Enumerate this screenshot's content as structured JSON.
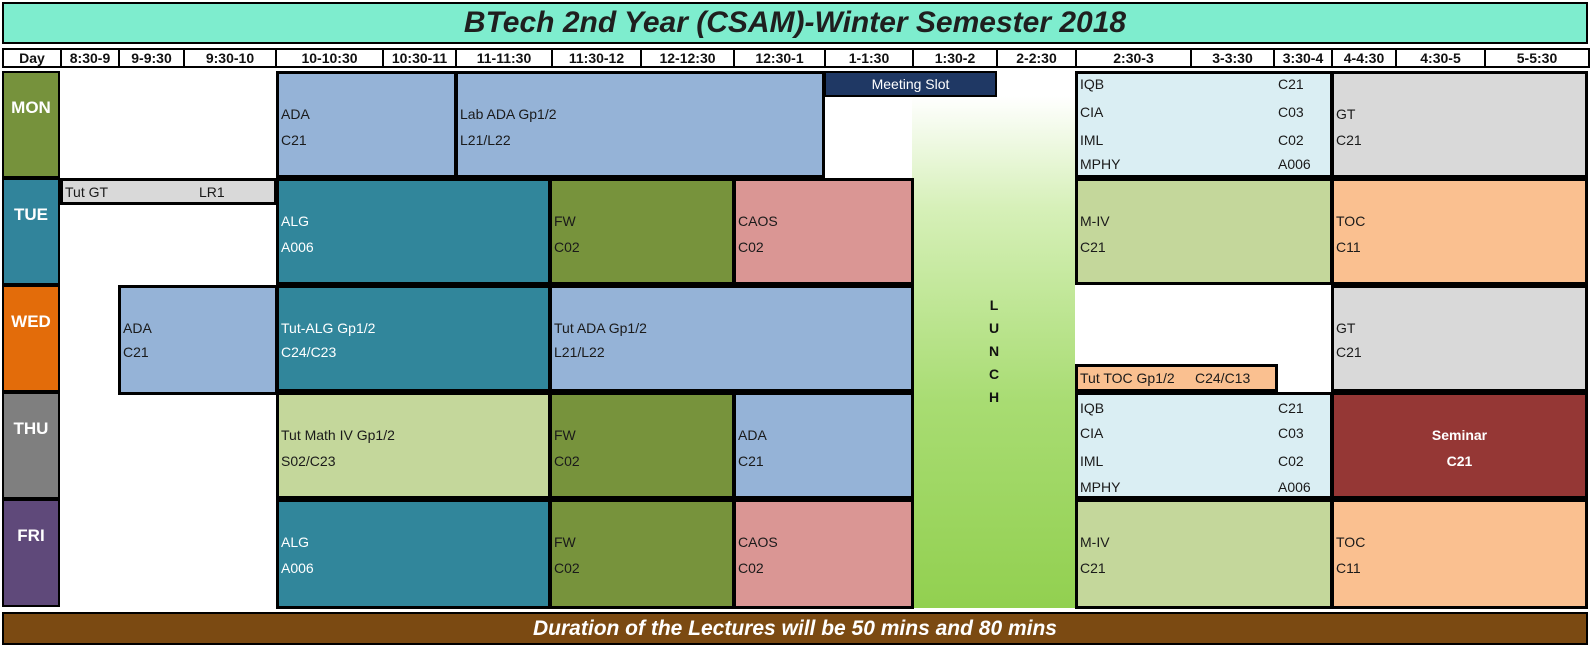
{
  "title": "BTech 2nd Year (CSAM)-Winter Semester 2018",
  "header": [
    "Day",
    "8:30-9",
    "9-9:30",
    "9:30-10",
    "10-10:30",
    "10:30-11",
    "11-11:30",
    "11:30-12",
    "12-12:30",
    "12:30-1",
    "1-1:30",
    "1:30-2",
    "2-2:30",
    "2:30-3",
    "3-3:30",
    "3:30-4",
    "4-4:30",
    "4:30-5",
    "5-5:30"
  ],
  "days": {
    "mon": {
      "label": "MON",
      "color": "#76923c"
    },
    "tue": {
      "label": "TUE",
      "color": "#31849b"
    },
    "wed": {
      "label": "WED",
      "color": "#e36c0a"
    },
    "thu": {
      "label": "THU",
      "color": "#7f7f7f"
    },
    "fri": {
      "label": "FRI",
      "color": "#5f497a"
    }
  },
  "colors": {
    "ada": "#95b3d7",
    "alg": "#31869b",
    "fw": "#77933c",
    "caos": "#da9694",
    "gt": "#d9d9d9",
    "toc": "#fac090",
    "m4": "#c4d79b",
    "elective": "#daeef3",
    "seminar": "#953735",
    "meeting": "#1f3864",
    "title": "#7eedce",
    "footer": "#7b4a12"
  },
  "meeting": "Meeting Slot",
  "lunch": [
    "L",
    "U",
    "N",
    "C",
    "H"
  ],
  "mon": {
    "ada": {
      "name": "ADA",
      "room": "C21"
    },
    "lab_ada": {
      "name": "Lab ADA Gp1/2",
      "room": "L21/L22"
    },
    "electives": [
      {
        "name": "IQB",
        "room": "C21"
      },
      {
        "name": "CIA",
        "room": "C03"
      },
      {
        "name": "IML",
        "room": "C02"
      },
      {
        "name": "MPHY",
        "room": "A006"
      }
    ],
    "gt": {
      "name": "GT",
      "room": "C21"
    }
  },
  "tue": {
    "tut_gt": {
      "name": "Tut GT",
      "room": "LR1"
    },
    "alg": {
      "name": "ALG",
      "room": "A006"
    },
    "fw": {
      "name": "FW",
      "room": "C02"
    },
    "caos": {
      "name": "CAOS",
      "room": "C02"
    },
    "m4": {
      "name": "M-IV",
      "room": "C21"
    },
    "toc": {
      "name": "TOC",
      "room": "C11"
    }
  },
  "wed": {
    "ada": {
      "name": "ADA",
      "room": "C21"
    },
    "tut_alg": {
      "name": "Tut-ALG Gp1/2",
      "room": "C24/C23"
    },
    "tut_ada": {
      "name": "Tut ADA Gp1/2",
      "room": "L21/L22"
    },
    "tut_toc": {
      "name": "Tut TOC Gp1/2",
      "room": "C24/C13"
    },
    "gt": {
      "name": "GT",
      "room": "C21"
    }
  },
  "thu": {
    "tut_math": {
      "name": "Tut Math IV Gp1/2",
      "room": "S02/C23"
    },
    "fw": {
      "name": "FW",
      "room": "C02"
    },
    "ada": {
      "name": "ADA",
      "room": "C21"
    },
    "electives": [
      {
        "name": "IQB",
        "room": "C21"
      },
      {
        "name": "CIA",
        "room": "C03"
      },
      {
        "name": "IML",
        "room": "C02"
      },
      {
        "name": "MPHY",
        "room": "A006"
      }
    ],
    "seminar": {
      "name": "Seminar",
      "room": "C21"
    }
  },
  "fri": {
    "alg": {
      "name": "ALG",
      "room": "A006"
    },
    "fw": {
      "name": "FW",
      "room": "C02"
    },
    "caos": {
      "name": "CAOS",
      "room": "C02"
    },
    "m4": {
      "name": "M-IV",
      "room": "C21"
    },
    "toc": {
      "name": "TOC",
      "room": "C11"
    }
  },
  "footer": "Duration of the Lectures will be 50 mins and 80 mins"
}
